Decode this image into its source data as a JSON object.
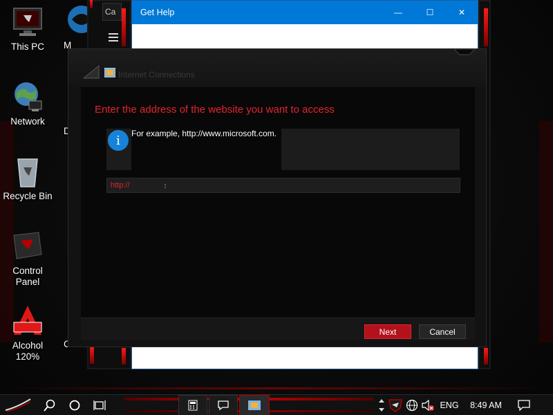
{
  "desktop": {
    "icons": [
      {
        "label": "This PC"
      },
      {
        "label": "Network"
      },
      {
        "label": "Recycle Bin"
      },
      {
        "label": "Control Panel"
      },
      {
        "label": "Alcohol 120%"
      }
    ],
    "partial_labels": {
      "col2_top": "M",
      "col2_mid": "D",
      "col2_bottom": "C"
    }
  },
  "back_window": {
    "title": "Get Help",
    "minimize": "—",
    "maximize": "☐",
    "close": "✕",
    "tab_partial": "Ca"
  },
  "dialog": {
    "title": "Internet Connections",
    "heading": "Enter the address of the website you want to access",
    "info_glyph": "i",
    "example": "For example, http://www.microsoft.com.",
    "url_value": "http://",
    "next_label": "Next",
    "cancel_label": "Cancel"
  },
  "taskbar": {
    "language": "ENG",
    "time": "8:49 AM"
  },
  "colors": {
    "accent_red": "#e3232e",
    "info_blue": "#1683d8",
    "titlebar_blue": "#0078d7"
  },
  "icons": [
    "start-icon",
    "search-icon",
    "cortana-icon",
    "task-view-icon",
    "calculator-icon",
    "feedback-icon",
    "app-icon",
    "scroll-arrows-icon",
    "rog-shield-icon",
    "network-icon",
    "volume-muted-icon",
    "notification-icon"
  ]
}
